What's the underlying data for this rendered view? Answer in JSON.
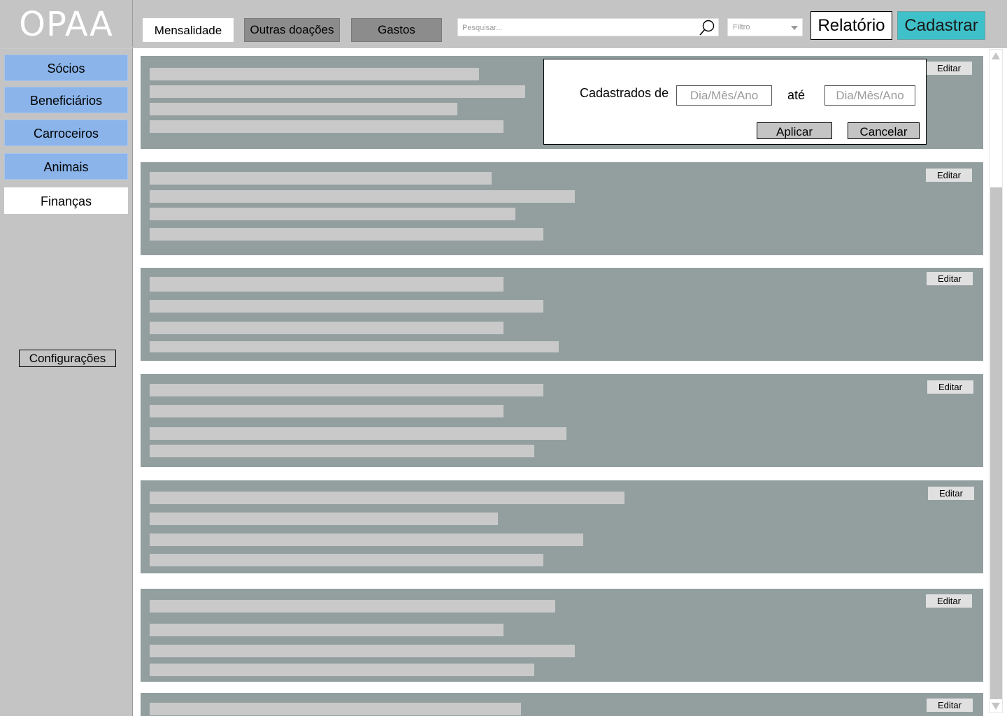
{
  "app": {
    "title": "OPAA"
  },
  "header": {
    "tabs": [
      {
        "label": "Mensalidade",
        "state": "active"
      },
      {
        "label": "Outras doações",
        "state": "inactive"
      },
      {
        "label": "Gastos",
        "state": "inactive"
      }
    ],
    "search_placeholder": "Pesquisar...",
    "filter_label": "Filtro",
    "report_button": "Relatório",
    "register_button": "Cadastrar",
    "colors": {
      "register_button": "#3fc1c9",
      "active_tab": "#ffffff",
      "inactive_tab": "#8c8c8c"
    }
  },
  "sidebar": {
    "items": [
      {
        "label": "Sócios"
      },
      {
        "label": "Beneficiários"
      },
      {
        "label": "Carroceiros"
      },
      {
        "label": "Animais"
      },
      {
        "label": "Finanças",
        "selected": true
      }
    ],
    "settings_button": "Configurações",
    "colors": {
      "item": "#8ab4ea",
      "selected_item": "#ffffff"
    }
  },
  "list": {
    "edit_label": "Editar",
    "item_count_visible": 7
  },
  "date_filter_popup": {
    "label_from": "Cadastrados de",
    "label_to": "até",
    "from_placeholder": "Dia/Mês/Ano",
    "to_placeholder": "Dia/Mês/Ano",
    "apply_button": "Aplicar",
    "cancel_button": "Cancelar"
  },
  "icons": {
    "search": "search-icon",
    "filter_dropdown": "chevron-down-icon",
    "scroll_up": "arrow-up-icon",
    "scroll_down": "arrow-down-icon"
  }
}
